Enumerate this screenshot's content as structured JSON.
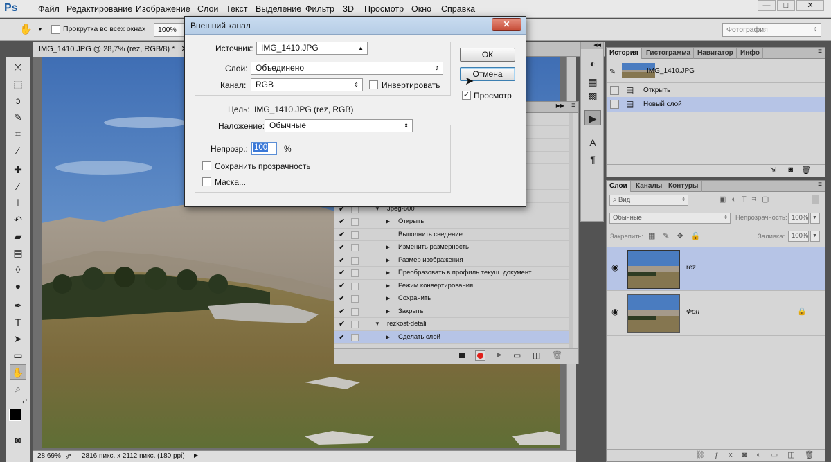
{
  "app": {
    "logo": "Ps"
  },
  "menu": [
    "Файл",
    "Редактирование",
    "Изображение",
    "Слои",
    "Текст",
    "Выделение",
    "Фильтр",
    "3D",
    "Просмотр",
    "Окно",
    "Справка"
  ],
  "window_controls": [
    "—",
    "□",
    "✕"
  ],
  "options_bar": {
    "scroll_all_label": "Прокрутка во всех окнах",
    "zoom_value": "100%",
    "workspace": "Фотография"
  },
  "document": {
    "tab_title": "IMG_1410.JPG @ 28,7% (rez, RGB/8) *",
    "zoom": "28,69%",
    "info": "2816 пикс. x 2112 пикс. (180 ppi)"
  },
  "dialog": {
    "title": "Внешний канал",
    "close": "✕",
    "source_label": "Источник:",
    "source_value": "IMG_1410.JPG",
    "layer_label": "Слой:",
    "layer_value": "Объединено",
    "channel_label": "Канал:",
    "channel_value": "RGB",
    "invert_label": "Инвертировать",
    "target_label": "Цель:",
    "target_value": "IMG_1410.JPG (rez, RGB)",
    "blending_label": "Наложение:",
    "blending_value": "Обычные",
    "opacity_label": "Непрозр.:",
    "opacity_value": "100",
    "opacity_unit": "%",
    "preserve_label": "Сохранить прозрачность",
    "mask_label": "Маска...",
    "ok_label": "ОК",
    "cancel_label": "Отмена",
    "preview_label": "Просмотр"
  },
  "actions": {
    "rows": [
      {
        "label": "",
        "indent": 0,
        "arrow": ""
      },
      {
        "label": "",
        "indent": 0,
        "arrow": ""
      },
      {
        "label": "",
        "indent": 0,
        "arrow": ""
      },
      {
        "label": "",
        "indent": 0,
        "arrow": ""
      },
      {
        "label": "",
        "indent": 0,
        "arrow": ""
      },
      {
        "label": "",
        "indent": 0,
        "arrow": ""
      },
      {
        "label": "",
        "indent": 0,
        "arrow": ""
      },
      {
        "label": "Jpeg-600",
        "indent": 1,
        "arrow": "▼"
      },
      {
        "label": "Открыть",
        "indent": 2,
        "arrow": "▶"
      },
      {
        "label": "Выполнить сведение",
        "indent": 2,
        "arrow": ""
      },
      {
        "label": "Изменить размерность",
        "indent": 2,
        "arrow": "▶"
      },
      {
        "label": "Размер изображения",
        "indent": 2,
        "arrow": "▶"
      },
      {
        "label": "Преобразовать в профиль текущ. документ",
        "indent": 2,
        "arrow": "▶"
      },
      {
        "label": "Режим конвертирования",
        "indent": 2,
        "arrow": "▶"
      },
      {
        "label": "Сохранить",
        "indent": 2,
        "arrow": "▶"
      },
      {
        "label": "Закрыть",
        "indent": 2,
        "arrow": "▶"
      },
      {
        "label": "rezkost-detali",
        "indent": 1,
        "arrow": "▼"
      },
      {
        "label": "Сделать слой",
        "indent": 2,
        "arrow": "▶"
      }
    ]
  },
  "history_panel": {
    "tabs": [
      "История",
      "Гистограмма",
      "Навигатор",
      "Инфо"
    ],
    "snapshot": "IMG_1410.JPG",
    "items": [
      "Открыть",
      "Новый слой"
    ]
  },
  "layers_panel": {
    "tabs": [
      "Слои",
      "Каналы",
      "Контуры"
    ],
    "kind_filter": "Вид",
    "blend_mode": "Обычные",
    "opacity_label": "Непрозрачность:",
    "opacity_value": "100%",
    "lock_label": "Закрепить:",
    "fill_label": "Заливка:",
    "fill_value": "100%",
    "layers": [
      "rez",
      "Фон"
    ]
  },
  "colors": {
    "selection": "#b6c4e6",
    "photo_sky": "#4a7cc0",
    "record": "#e0201a"
  }
}
